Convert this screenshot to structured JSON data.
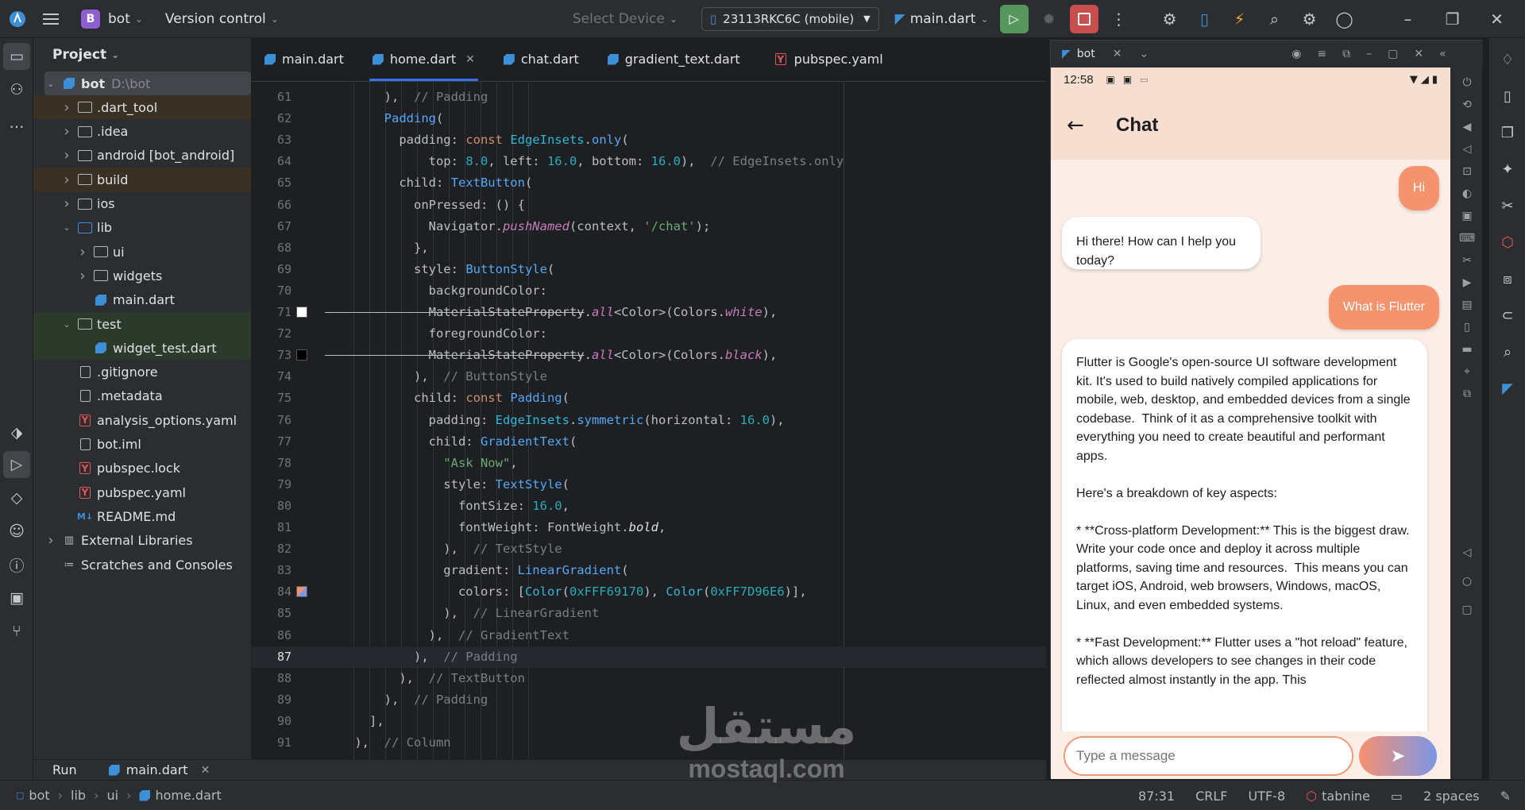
{
  "topbar": {
    "project_name": "bot",
    "project_badge": "B",
    "version_control": "Version control",
    "select_device": "Select Device",
    "device": "23113RKC6C (mobile)",
    "run_config": "main.dart"
  },
  "project_panel": {
    "title": "Project",
    "tree": [
      {
        "label": "bot",
        "extra": "D:\\bot",
        "depth": 0,
        "arrow": "down",
        "icon": "flutter"
      },
      {
        "label": ".dart_tool",
        "depth": 1,
        "arrow": "right",
        "icon": "folder"
      },
      {
        "label": ".idea",
        "depth": 1,
        "arrow": "right",
        "icon": "folder"
      },
      {
        "label": "android [bot_android]",
        "depth": 1,
        "arrow": "right",
        "icon": "folder"
      },
      {
        "label": "build",
        "depth": 1,
        "arrow": "right",
        "icon": "folder"
      },
      {
        "label": "ios",
        "depth": 1,
        "arrow": "right",
        "icon": "folder"
      },
      {
        "label": "lib",
        "depth": 1,
        "arrow": "down",
        "icon": "folder"
      },
      {
        "label": "ui",
        "depth": 2,
        "arrow": "right",
        "icon": "folder"
      },
      {
        "label": "widgets",
        "depth": 2,
        "arrow": "right",
        "icon": "folder"
      },
      {
        "label": "main.dart",
        "depth": 2,
        "arrow": "",
        "icon": "dart"
      },
      {
        "label": "test",
        "depth": 1,
        "arrow": "down",
        "icon": "folder"
      },
      {
        "label": "widget_test.dart",
        "depth": 2,
        "arrow": "",
        "icon": "dart"
      },
      {
        "label": ".gitignore",
        "depth": 1,
        "arrow": "",
        "icon": "file"
      },
      {
        "label": ".metadata",
        "depth": 1,
        "arrow": "",
        "icon": "file"
      },
      {
        "label": "analysis_options.yaml",
        "depth": 1,
        "arrow": "",
        "icon": "yaml"
      },
      {
        "label": "bot.iml",
        "depth": 1,
        "arrow": "",
        "icon": "file"
      },
      {
        "label": "pubspec.lock",
        "depth": 1,
        "arrow": "",
        "icon": "yaml"
      },
      {
        "label": "pubspec.yaml",
        "depth": 1,
        "arrow": "",
        "icon": "yaml"
      },
      {
        "label": "README.md",
        "depth": 1,
        "arrow": "",
        "icon": "md"
      },
      {
        "label": "External Libraries",
        "depth": 0,
        "arrow": "right",
        "icon": "lib"
      },
      {
        "label": "Scratches and Consoles",
        "depth": 0,
        "arrow": "",
        "icon": "scratch"
      }
    ]
  },
  "editor": {
    "tabs": [
      {
        "label": "main.dart",
        "icon": "dart"
      },
      {
        "label": "home.dart",
        "icon": "dart",
        "active": true
      },
      {
        "label": "chat.dart",
        "icon": "dart"
      },
      {
        "label": "gradient_text.dart",
        "icon": "dart"
      },
      {
        "label": "pubspec.yaml",
        "icon": "yaml"
      }
    ],
    "first_line": 61,
    "current_line": 87,
    "lines": [
      [
        [
          "c-p",
          "        ),  "
        ],
        [
          "c-c",
          "// Padding"
        ]
      ],
      [
        [
          "c-f",
          "        Padding"
        ],
        [
          "c-p",
          "("
        ]
      ],
      [
        [
          "c-p",
          "          padding: "
        ],
        [
          "c-k",
          "const "
        ],
        [
          "c-t",
          "EdgeInsets"
        ],
        [
          "c-p",
          "."
        ],
        [
          "c-f",
          "only"
        ],
        [
          "c-p",
          "("
        ]
      ],
      [
        [
          "c-p",
          "              top: "
        ],
        [
          "c-n",
          "8.0"
        ],
        [
          "c-p",
          ", left: "
        ],
        [
          "c-n",
          "16.0"
        ],
        [
          "c-p",
          ", bottom: "
        ],
        [
          "c-n",
          "16.0"
        ],
        [
          "c-p",
          "),  "
        ],
        [
          "c-c",
          "// EdgeInsets.only"
        ]
      ],
      [
        [
          "c-p",
          "          child: "
        ],
        [
          "c-f",
          "TextButton"
        ],
        [
          "c-p",
          "("
        ]
      ],
      [
        [
          "c-p",
          "            onPressed: () {"
        ]
      ],
      [
        [
          "c-p",
          "              Navigator."
        ],
        [
          "c-i",
          "pushNamed"
        ],
        [
          "c-p",
          "(context, "
        ],
        [
          "c-s",
          "'/chat'"
        ],
        [
          "c-p",
          ");"
        ]
      ],
      [
        [
          "c-p",
          "            },"
        ]
      ],
      [
        [
          "c-p",
          "            style: "
        ],
        [
          "c-f",
          "ButtonStyle"
        ],
        [
          "c-p",
          "("
        ]
      ],
      [
        [
          "c-p",
          "              backgroundColor:"
        ]
      ],
      [
        [
          "c-st",
          "              MaterialStateProperty"
        ],
        [
          "c-p",
          "."
        ],
        [
          "c-i",
          "all"
        ],
        [
          "c-p",
          "<Color>(Colors."
        ],
        [
          "c-i",
          "white"
        ],
        [
          "c-p",
          "),"
        ]
      ],
      [
        [
          "c-p",
          "              foregroundColor:"
        ]
      ],
      [
        [
          "c-st",
          "              MaterialStateProperty"
        ],
        [
          "c-p",
          "."
        ],
        [
          "c-i",
          "all"
        ],
        [
          "c-p",
          "<Color>(Colors."
        ],
        [
          "c-i",
          "black"
        ],
        [
          "c-p",
          "),"
        ]
      ],
      [
        [
          "c-p",
          "            ),  "
        ],
        [
          "c-c",
          "// ButtonStyle"
        ]
      ],
      [
        [
          "c-p",
          "            child: "
        ],
        [
          "c-k",
          "const "
        ],
        [
          "c-f",
          "Padding"
        ],
        [
          "c-p",
          "("
        ]
      ],
      [
        [
          "c-p",
          "              padding: "
        ],
        [
          "c-t",
          "EdgeInsets"
        ],
        [
          "c-p",
          "."
        ],
        [
          "c-f",
          "symmetric"
        ],
        [
          "c-p",
          "(horizontal: "
        ],
        [
          "c-n",
          "16.0"
        ],
        [
          "c-p",
          "),"
        ]
      ],
      [
        [
          "c-p",
          "              child: "
        ],
        [
          "c-f",
          "GradientText"
        ],
        [
          "c-p",
          "("
        ]
      ],
      [
        [
          "c-s",
          "                \"Ask Now\""
        ],
        [
          "c-p",
          ","
        ]
      ],
      [
        [
          "c-p",
          "                style: "
        ],
        [
          "c-f",
          "TextStyle"
        ],
        [
          "c-p",
          "("
        ]
      ],
      [
        [
          "c-p",
          "                  fontSize: "
        ],
        [
          "c-n",
          "16.0"
        ],
        [
          "c-p",
          ","
        ]
      ],
      [
        [
          "c-p",
          "                  fontWeight: FontWeight."
        ],
        [
          "c-it",
          "bold"
        ],
        [
          "c-p",
          ","
        ]
      ],
      [
        [
          "c-p",
          "                ),  "
        ],
        [
          "c-c",
          "// TextStyle"
        ]
      ],
      [
        [
          "c-p",
          "                gradient: "
        ],
        [
          "c-f",
          "LinearGradient"
        ],
        [
          "c-p",
          "("
        ]
      ],
      [
        [
          "c-p",
          "                  colors: ["
        ],
        [
          "c-t",
          "Color"
        ],
        [
          "c-p",
          "("
        ],
        [
          "c-n",
          "0xFFF69170"
        ],
        [
          "c-p",
          "), "
        ],
        [
          "c-t",
          "Color"
        ],
        [
          "c-p",
          "("
        ],
        [
          "c-n",
          "0xFF7D96E6"
        ],
        [
          "c-p",
          ")],"
        ]
      ],
      [
        [
          "c-p",
          "                ),  "
        ],
        [
          "c-c",
          "// LinearGradient"
        ]
      ],
      [
        [
          "c-p",
          "              ),  "
        ],
        [
          "c-c",
          "// GradientText"
        ]
      ],
      [
        [
          "c-p",
          "            ),  "
        ],
        [
          "c-c",
          "// Padding"
        ]
      ],
      [
        [
          "c-p",
          "          ),  "
        ],
        [
          "c-c",
          "// TextButton"
        ]
      ],
      [
        [
          "c-p",
          "        ),  "
        ],
        [
          "c-c",
          "// Padding"
        ]
      ],
      [
        [
          "c-p",
          "      ],"
        ]
      ],
      [
        [
          "c-p",
          "    ),  "
        ],
        [
          "c-c",
          "// Column"
        ]
      ]
    ],
    "swatches": [
      {
        "line": 71,
        "color": "#ffffff"
      },
      {
        "line": 73,
        "color": "#000000"
      },
      {
        "line": 84,
        "color": "gradient"
      }
    ]
  },
  "emulator": {
    "tab_label": "bot",
    "time": "12:58",
    "appbar_title": "Chat",
    "messages": [
      {
        "from": "user",
        "text": "Hi"
      },
      {
        "from": "bot",
        "text": "Hi there! How can I help you today?"
      },
      {
        "from": "user",
        "text": "What is Flutter"
      },
      {
        "from": "bot",
        "text": "Flutter is Google's open-source UI software development kit. It's used to build natively compiled applications for mobile, web, desktop, and embedded devices from a single codebase.  Think of it as a comprehensive toolkit with everything you need to create beautiful and performant apps.\n\nHere's a breakdown of key aspects:\n\n* **Cross-platform Development:** This is the biggest draw. Write your code once and deploy it across multiple platforms, saving time and resources.  This means you can target iOS, Android, web browsers, Windows, macOS, Linux, and even embedded systems.\n\n* **Fast Development:** Flutter uses a \"hot reload\" feature, which allows developers to see changes in their code reflected almost instantly in the app. This"
      }
    ],
    "input_placeholder": "Type a message",
    "colors": {
      "user_bubble": "#f5936e",
      "gradient_start": "#F69170",
      "gradient_end": "#7D96E6"
    }
  },
  "run_strip": {
    "label": "Run",
    "config": "main.dart"
  },
  "statusbar": {
    "breadcrumb": [
      "bot",
      "lib",
      "ui",
      "home.dart"
    ],
    "position": "87:31",
    "line_sep": "CRLF",
    "encoding": "UTF-8",
    "plugin": "tabnine",
    "indent": "2 spaces"
  },
  "watermark": {
    "arabic": "مستقل",
    "latin": "mostaql.com"
  }
}
